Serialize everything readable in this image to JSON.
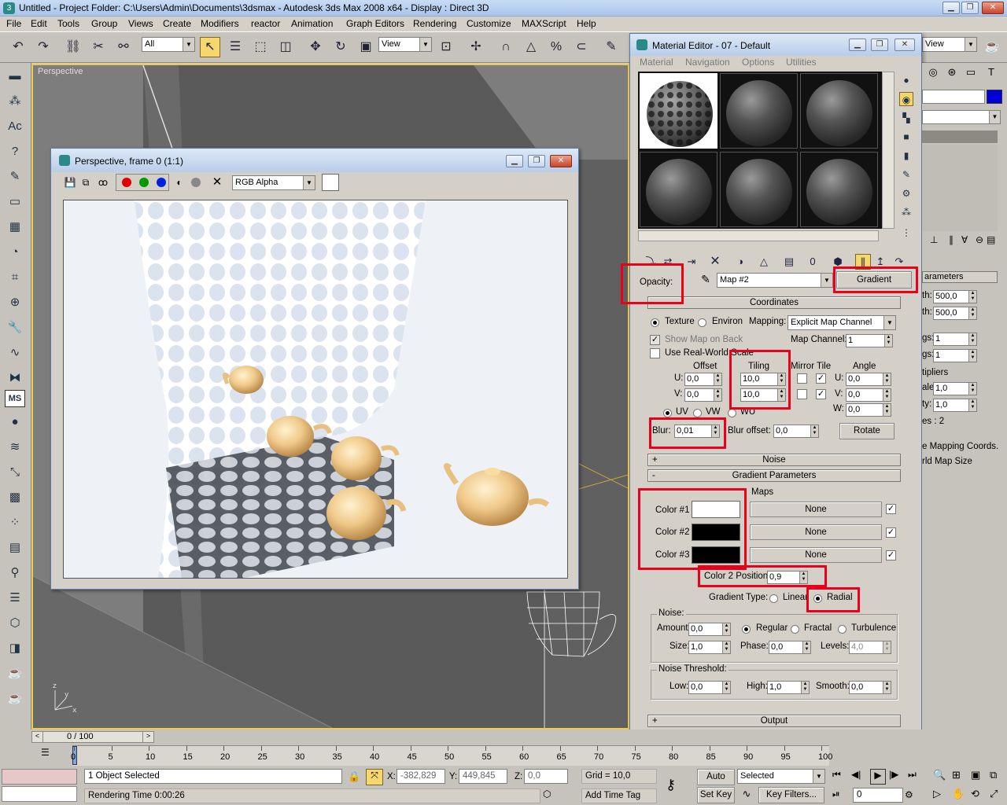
{
  "app": {
    "title": "Untitled     - Project Folder: C:\\Users\\Admin\\Documents\\3dsmax     - Autodesk 3ds Max 2008 x64     - Display : Direct 3D"
  },
  "menu": [
    "File",
    "Edit",
    "Tools",
    "Group",
    "Views",
    "Create",
    "Modifiers",
    "reactor",
    "Animation",
    "Graph Editors",
    "Rendering",
    "Customize",
    "MAXScript",
    "Help"
  ],
  "toolbar": {
    "selection_filter": "All",
    "ref_coord": "View",
    "ref_coord_right": "View"
  },
  "viewport": {
    "label": "Perspective"
  },
  "render_window": {
    "title": "Perspective, frame 0 (1:1)",
    "channel": "RGB Alpha"
  },
  "material_editor": {
    "title": "Material Editor - 07 - Default",
    "menu": [
      "Material",
      "Navigation",
      "Options",
      "Utilities"
    ],
    "map_label": "Opacity:",
    "map_name": "Map #2",
    "map_type": "Gradient",
    "coordinates": {
      "header": "Coordinates",
      "texture": "Texture",
      "environ": "Environ",
      "mapping_label": "Mapping:",
      "mapping": "Explicit Map Channel",
      "show_map_on_back": "Show Map on Back",
      "map_channel_label": "Map Channel:",
      "map_channel": "1",
      "real_world": "Use Real-World Scale",
      "offset": "Offset",
      "tiling": "Tiling",
      "mirror_tile": "Mirror Tile",
      "angle": "Angle",
      "u": "U:",
      "v": "V:",
      "w": "W:",
      "u_offset": "0,0",
      "v_offset": "0,0",
      "u_tiling": "10,0",
      "v_tiling": "10,0",
      "u_angle": "0,0",
      "v_angle": "0,0",
      "w_angle": "0,0",
      "uv": "UV",
      "vw": "VW",
      "wu": "WU",
      "blur_label": "Blur:",
      "blur": "0,01",
      "blur_offset_label": "Blur offset:",
      "blur_offset": "0,0",
      "rotate": "Rotate"
    },
    "noise_rollout": "Noise",
    "gradient": {
      "header": "Gradient Parameters",
      "maps": "Maps",
      "color1_label": "Color #1",
      "color2_label": "Color #2",
      "color3_label": "Color #3",
      "color1": "#ffffff",
      "color2": "#000000",
      "color3": "#000000",
      "map1": "None",
      "map2": "None",
      "map3": "None",
      "color2_pos_label": "Color 2 Position:",
      "color2_pos": "0,9",
      "type_label": "Gradient Type:",
      "linear": "Linear",
      "radial": "Radial",
      "noise_label": "Noise:",
      "amount_label": "Amount:",
      "amount": "0,0",
      "regular": "Regular",
      "fractal": "Fractal",
      "turbulence": "Turbulence",
      "size_label": "Size:",
      "size": "1,0",
      "phase_label": "Phase:",
      "phase": "0,0",
      "levels_label": "Levels:",
      "levels": "4,0",
      "threshold_label": "Noise Threshold:",
      "low_label": "Low:",
      "low": "0,0",
      "high_label": "High:",
      "high": "1,0",
      "smooth_label": "Smooth:",
      "smooth": "0,0"
    },
    "output_rollout": "Output"
  },
  "command_panel": {
    "header": "arameters",
    "len_label": "th:",
    "len1": "500,0",
    "len2": "500,0",
    "segs_label": "gs:",
    "seg1": "1",
    "seg2": "1",
    "multipliers": "tipliers",
    "scale_label": "ale:",
    "scale": "1,0",
    "density_label": "ty:",
    "density": "1,0",
    "faces": "es : 2",
    "gen_map": "e Mapping Coords.",
    "real_world": "rld Map Size"
  },
  "timeline": {
    "slider": "0 / 100",
    "ticks": [
      "0",
      "5",
      "10",
      "15",
      "20",
      "25",
      "30",
      "35",
      "40",
      "45",
      "50",
      "55",
      "60",
      "65",
      "70",
      "75",
      "80",
      "85",
      "90",
      "95",
      "100"
    ]
  },
  "status": {
    "selected": "1 Object Selected",
    "render_time": "Rendering Time  0:00:26",
    "x_label": "X:",
    "x": "-382,829",
    "y_label": "Y:",
    "y": "449,845",
    "z_label": "Z:",
    "z": "0,0",
    "grid": "Grid = 10,0",
    "add_time_tag": "Add Time Tag",
    "auto_key": "Auto Key",
    "set_key": "Set Key",
    "key_mode": "Selected",
    "key_filters": "Key Filters...",
    "frame": "0"
  }
}
